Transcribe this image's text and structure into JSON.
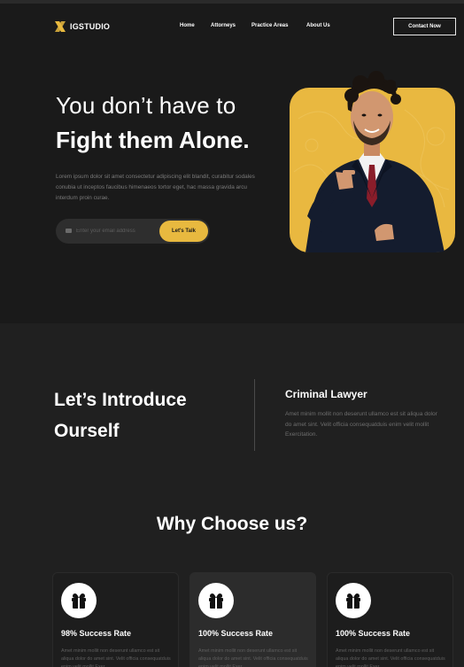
{
  "header": {
    "logo_text": "IGSTUDIO",
    "nav": [
      "Home",
      "Attorneys",
      "Practice Areas",
      "About Us"
    ],
    "contact_label": "Contact Now"
  },
  "hero": {
    "title_line1": "You don’t have to",
    "title_line2": "Fight them Alone.",
    "description": "Lorem ipsum dolor sit amet consectetur adipiscing elit blandit, curabitur sodales conubia ut inceptos faucibus himenaeos tortor eget, hac massa gravida arcu interdum proin curae.",
    "email_placeholder": "Enter your email address",
    "cta_label": "Let's Talk"
  },
  "intro": {
    "title_line1": "Let’s Introduce",
    "title_line2": "Ourself",
    "subtitle": "Criminal Lawyer",
    "description": "Amet minim mollit non deserunt ullamco est sit aliqua dolor do amet sint. Velit officia consequatduis enim velit mollit Exercitation."
  },
  "why": {
    "title": "Why Choose us?",
    "cards": [
      {
        "title": "98% Success Rate",
        "description": "Amet minim mollit non deserunt ullamco est sit aliqua dolor do amet sint. Velit officia consequatduis enim velit mollit Exer."
      },
      {
        "title": "100% Success Rate",
        "description": "Amet minim mollit non deserunt ullamco est sit aliqua dolor do amet sint. Velit officia consequatduis enim velit mollit Exer."
      },
      {
        "title": "100% Success Rate",
        "description": "Amet minim mollit non deserunt ullamco est sit aliqua dolor do amet sint. Velit officia consequatduis enim velit mollit Exer."
      }
    ]
  },
  "colors": {
    "accent": "#E8B93F",
    "background": "#1A1A1A",
    "section_bg": "#202020"
  },
  "icons": [
    "logo-x-icon",
    "mail-icon",
    "gift-icon"
  ]
}
